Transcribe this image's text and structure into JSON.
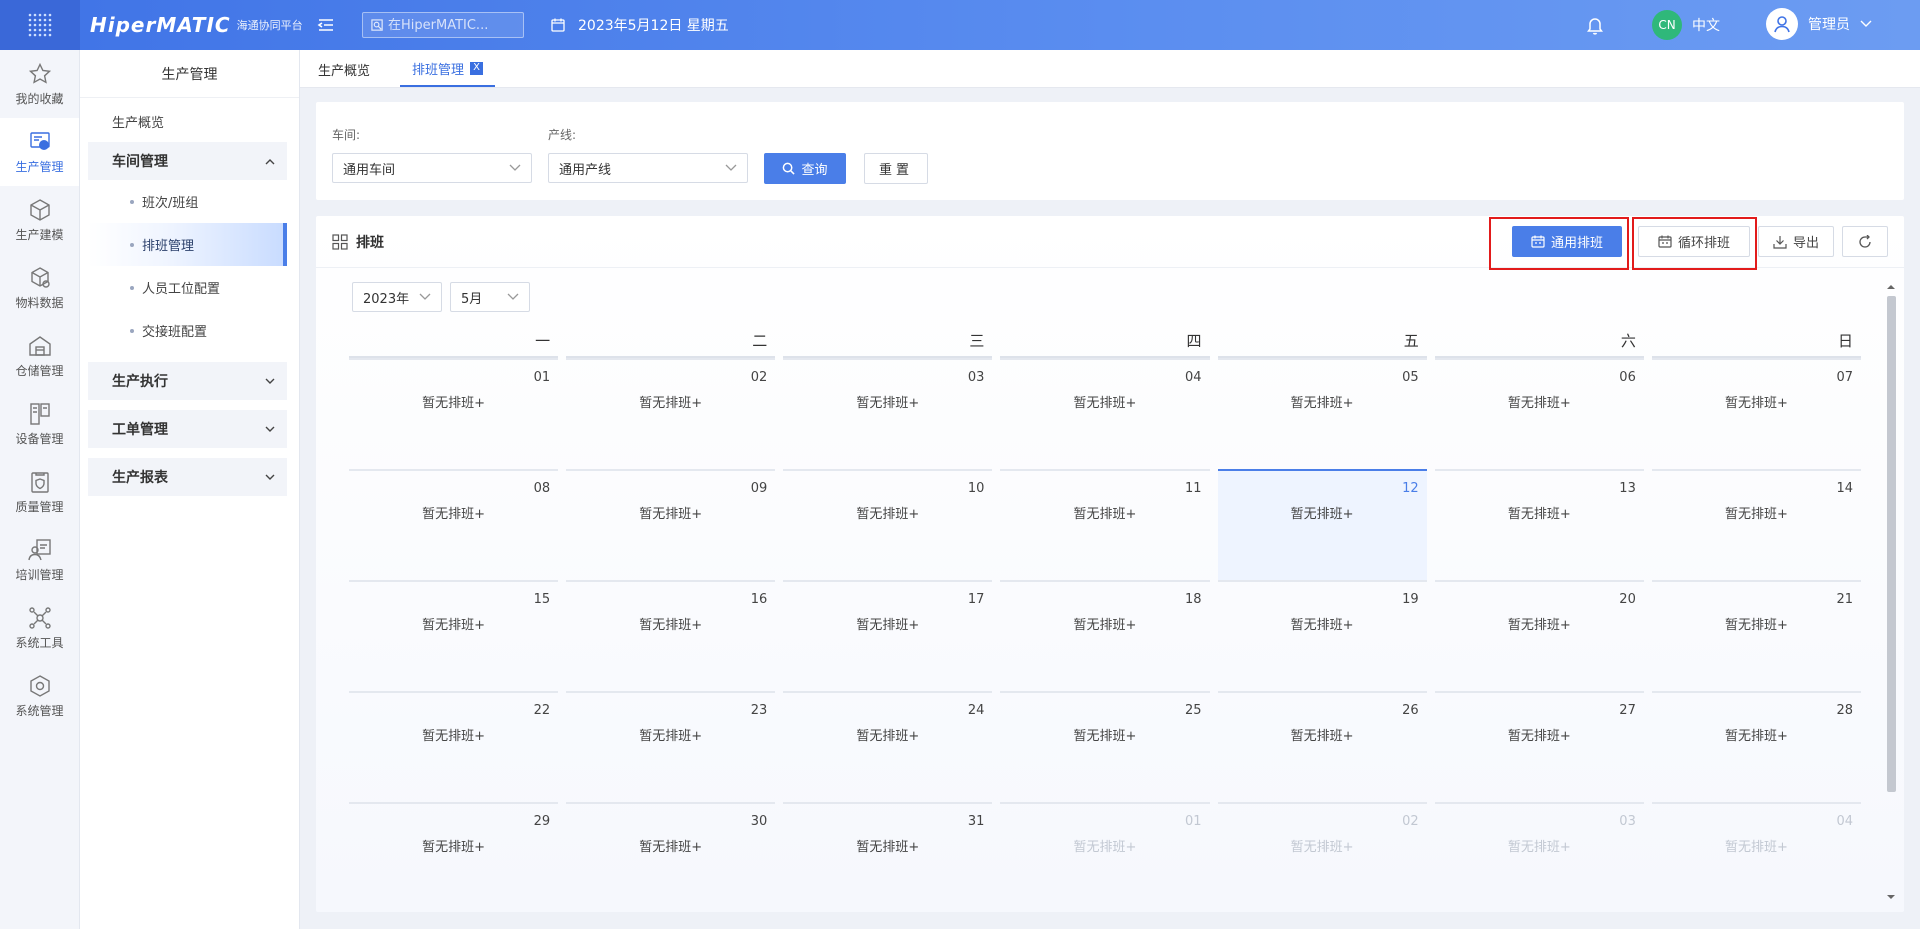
{
  "app": {
    "brand": "HiperMATIC",
    "brand_sub": "海通协同平台",
    "search_placeholder": "在HiperMATIC...",
    "date": "2023年5月12日 星期五",
    "lang_badge": "CN",
    "lang": "中文",
    "user": "管理员"
  },
  "iconbar": [
    {
      "label": "我的收藏",
      "icon": "star-icon"
    },
    {
      "label": "生产管理",
      "icon": "production-icon",
      "active": true
    },
    {
      "label": "生产建模",
      "icon": "cube-icon"
    },
    {
      "label": "物料数据",
      "icon": "material-icon"
    },
    {
      "label": "仓储管理",
      "icon": "warehouse-icon"
    },
    {
      "label": "设备管理",
      "icon": "device-icon"
    },
    {
      "label": "质量管理",
      "icon": "quality-icon"
    },
    {
      "label": "培训管理",
      "icon": "training-icon"
    },
    {
      "label": "系统工具",
      "icon": "tools-icon"
    },
    {
      "label": "系统管理",
      "icon": "system-icon"
    }
  ],
  "sidebar": {
    "title": "生产管理",
    "overview": "生产概览",
    "group_workshop": "车间管理",
    "subs": [
      "班次/班组",
      "排班管理",
      "人员工位配置",
      "交接班配置"
    ],
    "group_exec": "生产执行",
    "group_order": "工单管理",
    "group_report": "生产报表"
  },
  "tabs": {
    "overview": "生产概览",
    "schedule": "排班管理",
    "close": "X"
  },
  "filter": {
    "workshop_label": "车间:",
    "workshop_value": "通用车间",
    "line_label": "产线:",
    "line_value": "通用产线",
    "query": "查询",
    "reset": "重置"
  },
  "panel": {
    "title": "排班",
    "btn_general": "通用排班",
    "btn_cycle": "循环排班",
    "btn_export": "导出",
    "year": "2023年",
    "month": "5月"
  },
  "calendar": {
    "weekdays": [
      "一",
      "二",
      "三",
      "四",
      "五",
      "六",
      "日"
    ],
    "empty_label": "暂无排班+",
    "days": [
      {
        "d": "01"
      },
      {
        "d": "02"
      },
      {
        "d": "03"
      },
      {
        "d": "04"
      },
      {
        "d": "05"
      },
      {
        "d": "06"
      },
      {
        "d": "07"
      },
      {
        "d": "08"
      },
      {
        "d": "09"
      },
      {
        "d": "10"
      },
      {
        "d": "11"
      },
      {
        "d": "12",
        "today": true
      },
      {
        "d": "13"
      },
      {
        "d": "14"
      },
      {
        "d": "15"
      },
      {
        "d": "16"
      },
      {
        "d": "17"
      },
      {
        "d": "18"
      },
      {
        "d": "19"
      },
      {
        "d": "20"
      },
      {
        "d": "21"
      },
      {
        "d": "22"
      },
      {
        "d": "23"
      },
      {
        "d": "24"
      },
      {
        "d": "25"
      },
      {
        "d": "26"
      },
      {
        "d": "27"
      },
      {
        "d": "28"
      },
      {
        "d": "29"
      },
      {
        "d": "30"
      },
      {
        "d": "31"
      },
      {
        "d": "01",
        "other": true
      },
      {
        "d": "02",
        "other": true
      },
      {
        "d": "03",
        "other": true
      },
      {
        "d": "04",
        "other": true
      }
    ]
  }
}
